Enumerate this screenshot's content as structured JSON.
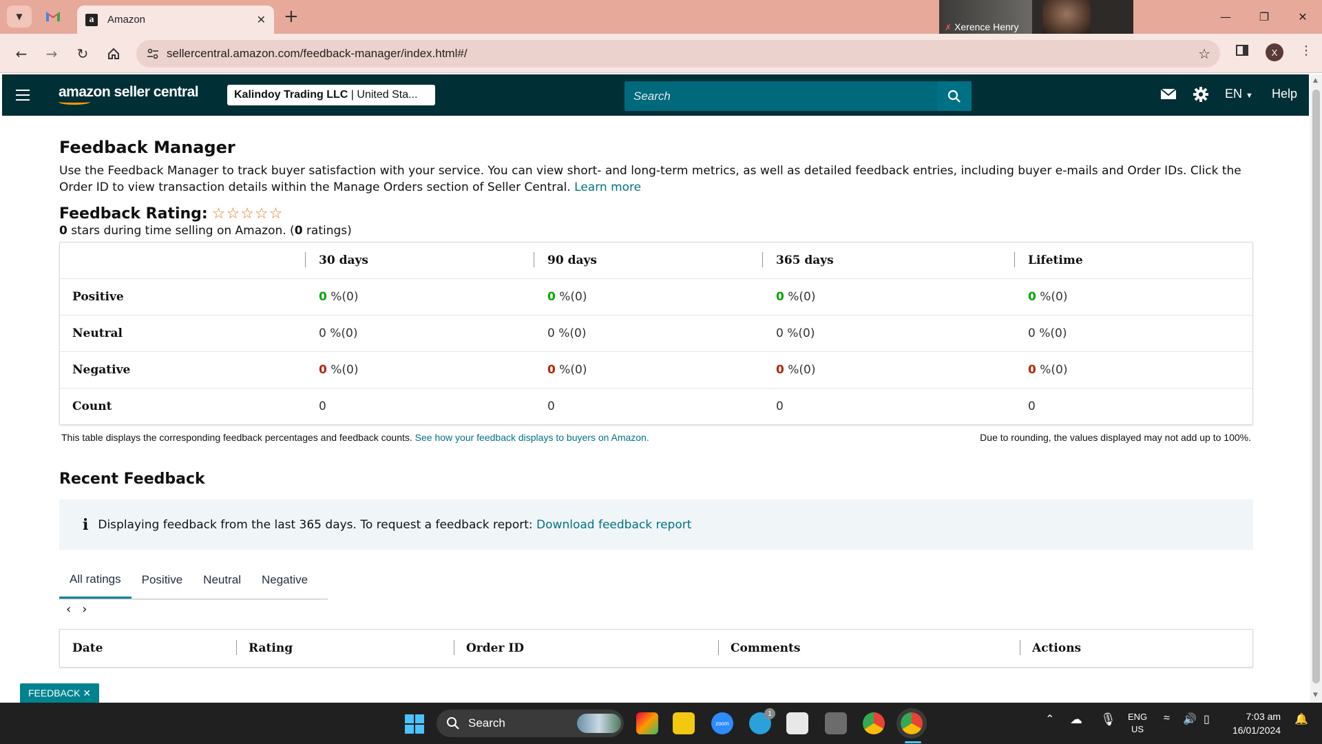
{
  "browser": {
    "tab_title": "Amazon",
    "url": "sellercentral.amazon.com/feedback-manager/index.html#/",
    "profile_initial": "X",
    "video_participant": "Xerence Henry"
  },
  "header": {
    "logo": "amazon seller central",
    "account_name": "Kalindoy Trading LLC",
    "account_region": "United Sta...",
    "search_placeholder": "Search",
    "language": "EN",
    "help": "Help"
  },
  "page": {
    "title": "Feedback Manager",
    "intro": "Use the Feedback Manager to track buyer satisfaction with your service. You can view short- and long-term metrics, as well as detailed feedback entries, including buyer e-mails and Order IDs. Click the Order ID to view transaction details within the Manage Orders section of Seller Central.",
    "learn_more": "Learn more",
    "rating_title": "Feedback Rating:",
    "rating_stars_value": "0",
    "rating_sub_mid": "stars during time selling on Amazon. (",
    "rating_count": "0",
    "rating_sub_end": "ratings)"
  },
  "metrics": {
    "columns": [
      "30 days",
      "90 days",
      "365 days",
      "Lifetime"
    ],
    "rows": [
      {
        "label": "Positive",
        "cells": [
          [
            "0",
            "%(0)"
          ],
          [
            "0",
            "%(0)"
          ],
          [
            "0",
            "%(0)"
          ],
          [
            "0",
            "%(0)"
          ]
        ]
      },
      {
        "label": "Neutral",
        "cells": [
          [
            "0",
            "%(0)"
          ],
          [
            "0",
            "%(0)"
          ],
          [
            "0",
            "%(0)"
          ],
          [
            "0",
            "%(0)"
          ]
        ]
      },
      {
        "label": "Negative",
        "cells": [
          [
            "0",
            "%(0)"
          ],
          [
            "0",
            "%(0)"
          ],
          [
            "0",
            "%(0)"
          ],
          [
            "0",
            "%(0)"
          ]
        ]
      },
      {
        "label": "Count",
        "cells": [
          [
            "0",
            ""
          ],
          [
            "0",
            ""
          ],
          [
            "0",
            ""
          ],
          [
            "0",
            ""
          ]
        ]
      }
    ],
    "note_left": "This table displays the corresponding feedback percentages and feedback counts.",
    "note_link": "See how your feedback displays to buyers on Amazon.",
    "note_right": "Due to rounding, the values displayed may not add up to 100%."
  },
  "recent": {
    "title": "Recent Feedback",
    "info_text": "Displaying feedback from the last 365 days. To request a feedback report:",
    "info_link": "Download feedback report",
    "tabs": [
      "All ratings",
      "Positive",
      "Neutral",
      "Negative"
    ],
    "active_tab": "All ratings",
    "table_columns": [
      "Date",
      "Rating",
      "Order ID",
      "Comments",
      "Actions"
    ]
  },
  "feedback_pill": "FEEDBACK",
  "taskbar": {
    "search": "Search",
    "lang_top": "ENG",
    "lang_bottom": "US",
    "time": "7:03 am",
    "date": "16/01/2024",
    "telegram_badge": "1"
  },
  "colors": {
    "header_bg": "#002f36",
    "search_bg": "#00697c",
    "link": "#007185",
    "positive": "#00a800",
    "negative": "#b12704",
    "star": "#de7921"
  }
}
